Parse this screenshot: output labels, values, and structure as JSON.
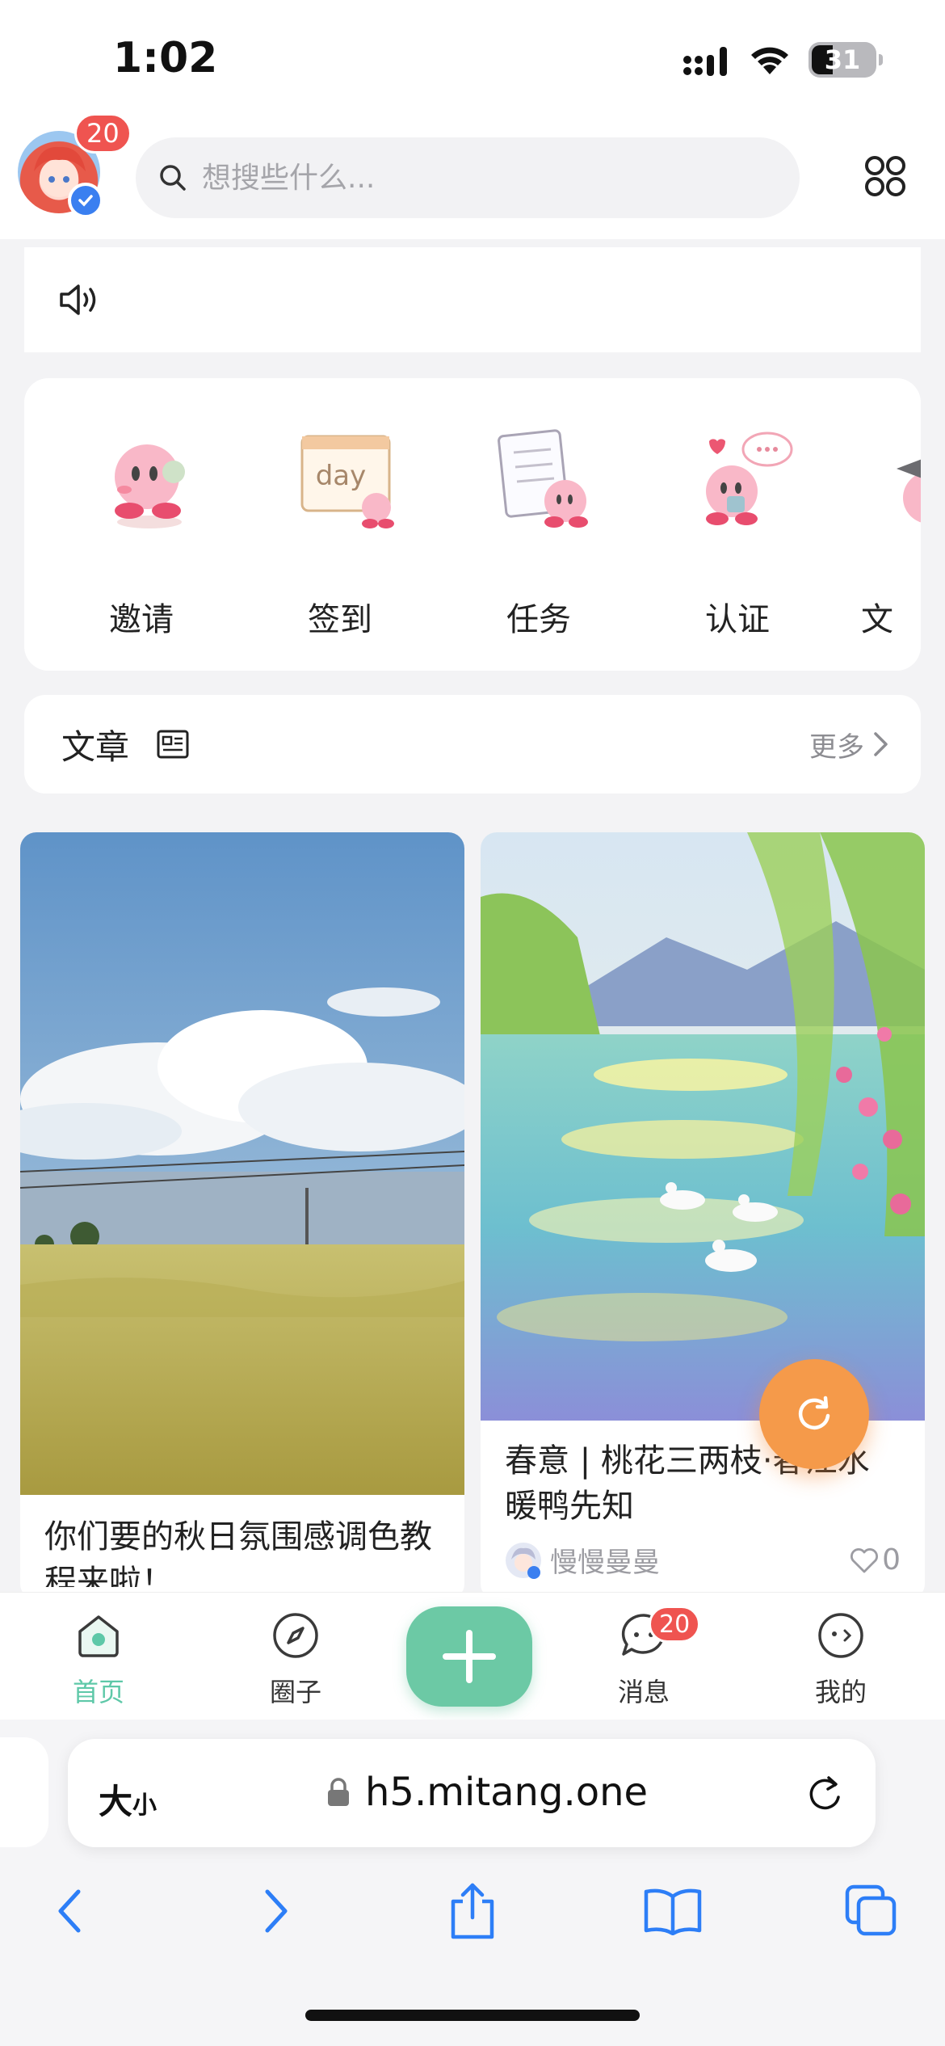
{
  "status_bar": {
    "time": "1:02",
    "battery": "31"
  },
  "header": {
    "avatar_badge": "20",
    "search_placeholder": "想搜些什么..."
  },
  "shortcuts": [
    {
      "label": "邀请"
    },
    {
      "label": "签到",
      "icon_text": "day"
    },
    {
      "label": "任务"
    },
    {
      "label": "认证"
    },
    {
      "label": "文"
    }
  ],
  "article_section": {
    "title": "文章",
    "more": "更多"
  },
  "cards": [
    {
      "title": "你们要的秋日氛围感调色教程来啦！",
      "author": "",
      "likes": ""
    },
    {
      "title": "春意 | 桃花三两枝·春江水暖鸭先知",
      "author": "慢慢曼曼",
      "likes": "0"
    }
  ],
  "tabbar": {
    "home": "首页",
    "circle": "圈子",
    "messages": "消息",
    "messages_badge": "20",
    "mine": "我的"
  },
  "browser": {
    "text_size": "大",
    "text_size_small": "小",
    "url": "h5.mitang.one"
  },
  "colors": {
    "accent": "#5ec8a8",
    "badge": "#ef5450",
    "fab": "#f59a4a"
  }
}
